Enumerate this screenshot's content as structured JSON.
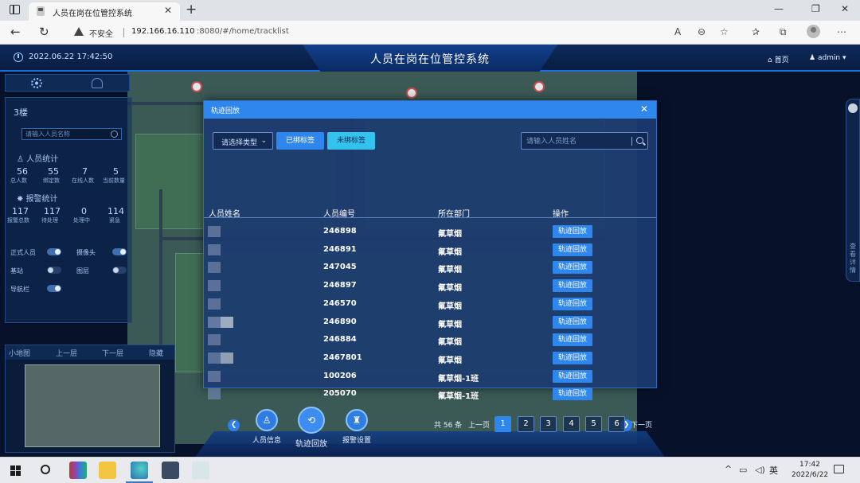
{
  "browser": {
    "tab_title": "人员在岗在位管控系统",
    "tab_close": "✕",
    "new_tab": "+",
    "security_label": "不安全",
    "url_host": "192.166.16.110",
    "url_path": ":8080/#/home/tracklist",
    "window_min": "—",
    "window_max": "❐",
    "window_close": "✕"
  },
  "header": {
    "datetime": "2022.06.22 17:42:50",
    "title": "人员在岗在位管控系统",
    "home_label": "首页",
    "user_label": "admin"
  },
  "left_panel": {
    "floor": "3楼",
    "search_placeholder": "请输入人员名称",
    "stats_title": "人员统计",
    "stats": [
      {
        "value": "56",
        "label": "总人数"
      },
      {
        "value": "55",
        "label": "绑定数"
      },
      {
        "value": "7",
        "label": "在线人数"
      },
      {
        "value": "5",
        "label": "当前数量"
      }
    ],
    "alarm_title": "报警统计",
    "alarms": [
      {
        "value": "117",
        "label": "报警总数"
      },
      {
        "value": "117",
        "label": "待处理"
      },
      {
        "value": "0",
        "label": "处理中"
      },
      {
        "value": "114",
        "label": "紧急"
      }
    ],
    "toggles": [
      {
        "label": "正式人员",
        "on": true
      },
      {
        "label": "摄像头",
        "on": true
      },
      {
        "label": "基站",
        "on": false
      },
      {
        "label": "图层",
        "on": false
      },
      {
        "label": "导航栏",
        "on": true
      }
    ]
  },
  "mini_map": {
    "label": "小地图",
    "prev_floor": "上一层",
    "next_floor": "下一层",
    "hide": "隐藏"
  },
  "modal": {
    "title": "轨迹回放",
    "close": "✕",
    "select_type": "请选择类型",
    "btn_bound": "已绑标签",
    "btn_unbound": "未绑标签",
    "search_placeholder": "请输入人员姓名",
    "columns": {
      "name": "人员姓名",
      "id": "人员编号",
      "dept": "所在部门",
      "action": "操作"
    },
    "rows": [
      {
        "id": "246898",
        "dept": "氟草烟",
        "action": "轨迹回放"
      },
      {
        "id": "246891",
        "dept": "氟草烟",
        "action": "轨迹回放"
      },
      {
        "id": "247045",
        "dept": "氟草烟",
        "action": "轨迹回放"
      },
      {
        "id": "246897",
        "dept": "氟草烟",
        "action": "轨迹回放"
      },
      {
        "id": "246570",
        "dept": "氟草烟",
        "action": "轨迹回放"
      },
      {
        "id": "246890",
        "dept": "氟草烟",
        "action": "轨迹回放"
      },
      {
        "id": "246884",
        "dept": "氟草烟",
        "action": "轨迹回放"
      },
      {
        "id": "2467801",
        "dept": "氟草烟",
        "action": "轨迹回放"
      },
      {
        "id": "100206",
        "dept": "氟草烟-1班",
        "action": "轨迹回放"
      },
      {
        "id": "205070",
        "dept": "氟草烟-1班",
        "action": "轨迹回放"
      }
    ],
    "pagination": {
      "total": "共 56 条",
      "prev": "上一页",
      "next": "下一页",
      "pages": [
        "1",
        "2",
        "3",
        "4",
        "5",
        "6"
      ],
      "current": "1"
    }
  },
  "bottom_nav": [
    {
      "label": "人员信息",
      "icon": "person-info-icon"
    },
    {
      "label": "轨迹回放",
      "icon": "history-icon"
    },
    {
      "label": "报警设置",
      "icon": "alarm-bell-icon"
    }
  ],
  "right_handle": {
    "text": "查看详情"
  },
  "taskbar": {
    "time": "17:42",
    "date": "2022/6/22",
    "lang": "英"
  },
  "colors": {
    "primary": "#2f86ec",
    "accent": "#34c3ee",
    "header_bg": "#0c2a5c"
  }
}
